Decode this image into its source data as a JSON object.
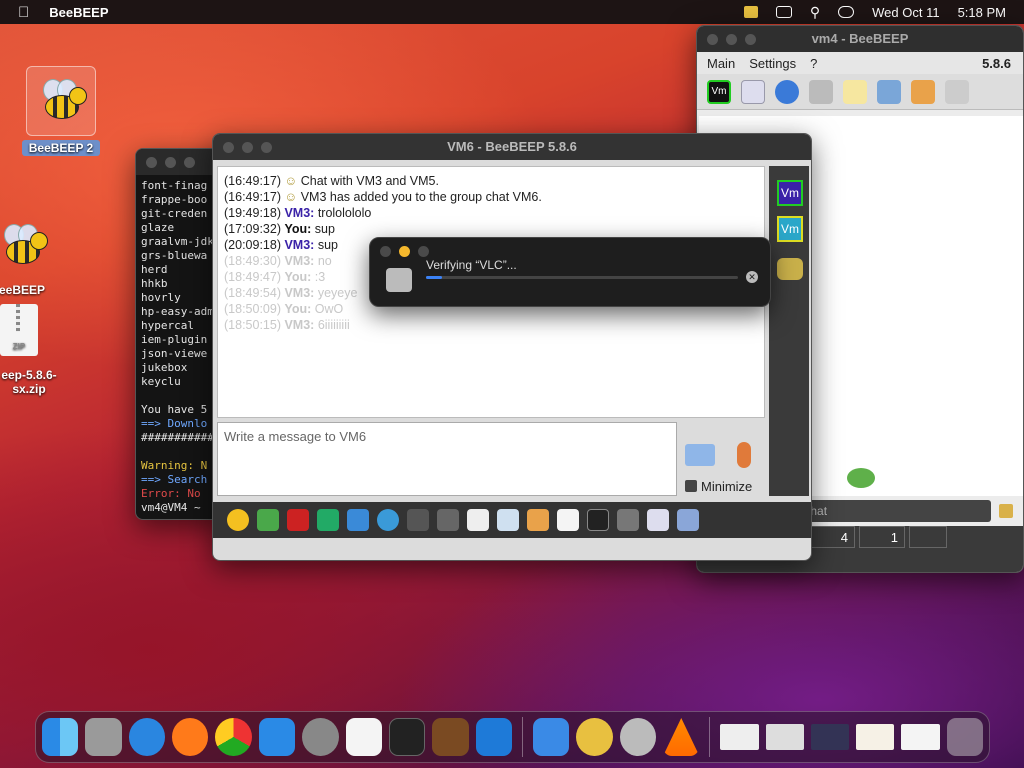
{
  "menubar": {
    "app": "BeeBEEP",
    "date": "Wed Oct 11",
    "time": "5:18 PM"
  },
  "desktop": {
    "bee2": "BeeBEEP 2",
    "bee_partial": "eeBEEP",
    "zip_name1": "eep-5.8.6-",
    "zip_name2": "sx.zip",
    "zip_badge": "ZIP"
  },
  "terminal": {
    "lines": [
      "font-finag",
      "frappe-boo",
      "git-creden",
      "glaze",
      "graalvm-jdk",
      "grs-bluewa",
      "herd",
      "hhkb",
      "hovrly",
      "hp-easy-adm",
      "hypercal",
      "iem-plugin",
      "json-viewe",
      "jukebox",
      "keyclu",
      "",
      "You have 5",
      "==> Downlo",
      "###########",
      "",
      "Warning: N",
      "==> Search",
      "Error: No",
      "vm4@VM4 ~"
    ]
  },
  "vm4": {
    "title": "vm4 - BeeBEEP",
    "menu": [
      "Main",
      "Settings",
      "?"
    ],
    "version": "5.8.6",
    "search": "Search chat",
    "counts": {
      "chats": "4",
      "users": "1"
    }
  },
  "vm6": {
    "title": "VM6 - BeeBEEP 5.8.6",
    "messages": [
      {
        "time": "(16:49:17)",
        "who": "",
        "text": "Chat with VM3 and VM5.",
        "faded": false
      },
      {
        "time": "(16:49:17)",
        "who": "",
        "text": "VM3 has added you to the group chat VM6.",
        "faded": false
      },
      {
        "time": "(19:49:18)",
        "who": "VM3",
        "text": "trololololo",
        "faded": false
      },
      {
        "time": "(17:09:32)",
        "who": "You",
        "text": "sup",
        "faded": false
      },
      {
        "time": "(20:09:18)",
        "who": "VM3",
        "text": "sup",
        "faded": false
      },
      {
        "time": "(18:49:30)",
        "who": "VM3",
        "text": "no",
        "faded": true
      },
      {
        "time": "(18:49:47)",
        "who": "You",
        "text": ":3",
        "faded": true
      },
      {
        "time": "(18:49:54)",
        "who": "VM3",
        "text": "yeyeye",
        "faded": true
      },
      {
        "time": "(18:50:09)",
        "who": "You",
        "text": "OwO",
        "faded": true
      },
      {
        "time": "(18:50:15)",
        "who": "VM3",
        "text": "6iiiiiiiii",
        "faded": true
      }
    ],
    "input_placeholder": "Write a message to VM6",
    "minimize": "Minimize",
    "user_badges": [
      "Vm",
      "Vm"
    ]
  },
  "popup": {
    "text": "Verifying “VLC”...",
    "progress": 0.05
  },
  "colors": {
    "vmname": "#3a22a8",
    "accent": "#3b82f6"
  }
}
